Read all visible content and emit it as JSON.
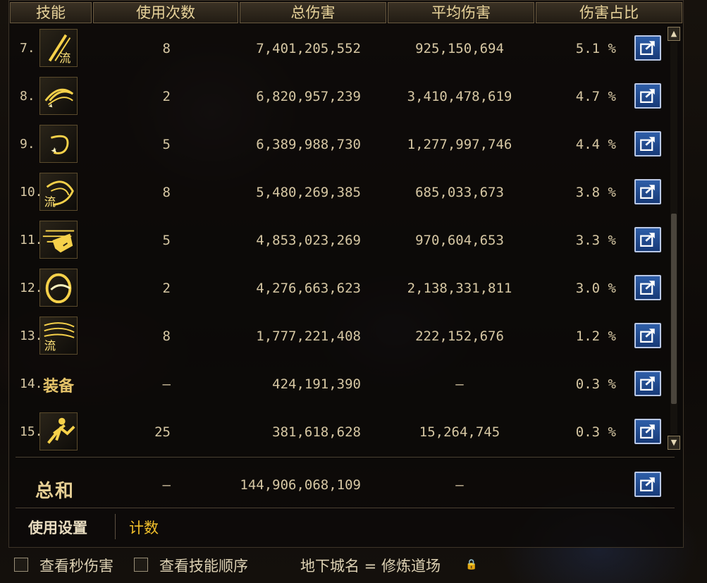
{
  "columns": [
    "技能",
    "使用次数",
    "总伤害",
    "平均伤害",
    "伤害占比"
  ],
  "rows": [
    {
      "index": "7.",
      "icon": "sword-slash-flow-icon",
      "uses": "8",
      "total": "7,401,205,552",
      "avg": "925,150,694",
      "pct": "5.1 %"
    },
    {
      "index": "8.",
      "icon": "spiral-slash-icon",
      "uses": "2",
      "total": "6,820,957,239",
      "avg": "3,410,478,619",
      "pct": "4.7 %"
    },
    {
      "index": "9.",
      "icon": "crescent-star-icon",
      "uses": "5",
      "total": "6,389,988,730",
      "avg": "1,277,997,746",
      "pct": "4.4 %"
    },
    {
      "index": "10.",
      "icon": "arc-flow-icon",
      "uses": "8",
      "total": "5,480,269,385",
      "avg": "685,033,673",
      "pct": "3.8 %"
    },
    {
      "index": "11.",
      "icon": "beast-charge-icon",
      "uses": "5",
      "total": "4,853,023,269",
      "avg": "970,604,653",
      "pct": "3.3 %"
    },
    {
      "index": "12.",
      "icon": "swirl-orb-icon",
      "uses": "2",
      "total": "4,276,663,623",
      "avg": "2,138,331,811",
      "pct": "3.0 %"
    },
    {
      "index": "13.",
      "icon": "wind-flow-icon",
      "uses": "8",
      "total": "1,777,221,408",
      "avg": "222,152,676",
      "pct": "1.2 %"
    },
    {
      "index": "14.",
      "icon": "equipment-text-icon",
      "icon_text": "装备",
      "uses": "–",
      "total": "424,191,390",
      "avg": "–",
      "pct": "0.3 %"
    },
    {
      "index": "15.",
      "icon": "leaping-strike-icon",
      "uses": "25",
      "total": "381,618,628",
      "avg": "15,264,745",
      "pct": "0.3 %"
    }
  ],
  "summary": {
    "label": "总和",
    "uses": "–",
    "total": "144,906,068,109",
    "avg": "–"
  },
  "tabs": {
    "settings": "使用设置",
    "count": "计数"
  },
  "footer": {
    "dps_checkbox": "查看秒伤害",
    "order_checkbox": "查看技能顺序",
    "dungeon": "地下城名 = 修炼道场"
  },
  "colors": {
    "accent_gold": "#f2c02b",
    "header_text": "#e8d39a",
    "share_button": "#2e5ea8"
  }
}
